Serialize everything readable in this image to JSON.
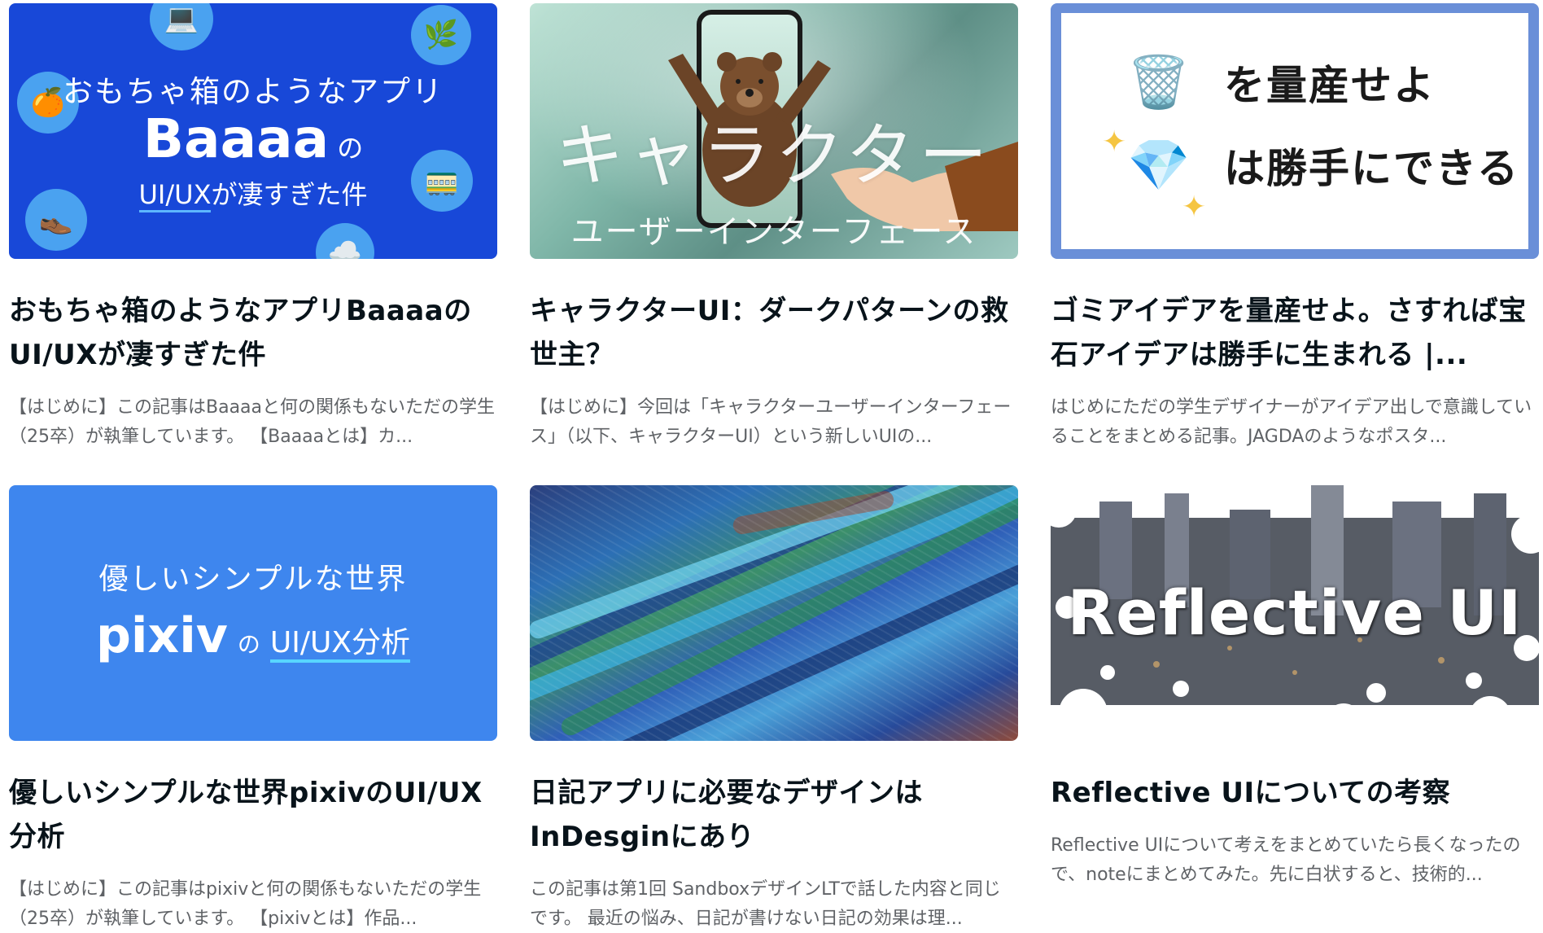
{
  "cards": [
    {
      "title": "おもちゃ箱のようなアプリBaaaaのUI/UXが凄すぎた件",
      "excerpt": "【はじめに】この記事はBaaaaと何の関係もないただの学生（25卒）が執筆しています。 【Baaaaとは】カ...",
      "thumb": {
        "line1": "おもちゃ箱のようなアプリ",
        "brand": "Baaaa",
        "no": "の",
        "line3_a": "UI/UX",
        "line3_b": "が凄すぎた件",
        "icons": [
          "laptop-icon",
          "leaf-icon",
          "orange-icon",
          "train-icon",
          "shoe-icon",
          "cloud-icon"
        ],
        "bg": "#1848d8"
      }
    },
    {
      "title": "キャラクターUI：ダークパターンの救世主？",
      "excerpt": "【はじめに】今回は「キャラクターユーザーインターフェース」（以下、キャラクターUI）という新しいUIの...",
      "thumb": {
        "big": "キャラクター",
        "sub": "ユーザーインターフェース"
      }
    },
    {
      "title": "ゴミアイデアを量産せよ。さすれば宝石アイデアは勝手に生まれる |...",
      "excerpt": "はじめにただの学生デザイナーがアイデア出しで意識していることをまとめる記事。JAGDAのようなポスタ...",
      "thumb": {
        "row1": "を量産せよ",
        "row2": "は勝手にできる",
        "frame": "#6a8fd8"
      }
    },
    {
      "title": "優しいシンプルな世界pixivのUI/UX分析",
      "excerpt": "【はじめに】この記事はpixivと何の関係もないただの学生（25卒）が執筆しています。 【pixivとは】作品...",
      "thumb": {
        "line1": "優しいシンプルな世界",
        "brand": "pixiv",
        "no": "の",
        "uiux": "UI/UX分析",
        "bg": "#3e86ee"
      }
    },
    {
      "title": "日記アプリに必要なデザインはInDesginにあり",
      "excerpt": "この記事は第1回 SandboxデザインLTで話した内容と同じです。 最近の悩み、日記が書けない日記の効果は理...",
      "thumb": {}
    },
    {
      "title": "Reflective UIについての考察",
      "excerpt": "Reflective UIについて考えをまとめていたら長くなったので、noteにまとめてみた。先に白状すると、技術的...",
      "thumb": {
        "big": "Reflective UI"
      }
    }
  ]
}
